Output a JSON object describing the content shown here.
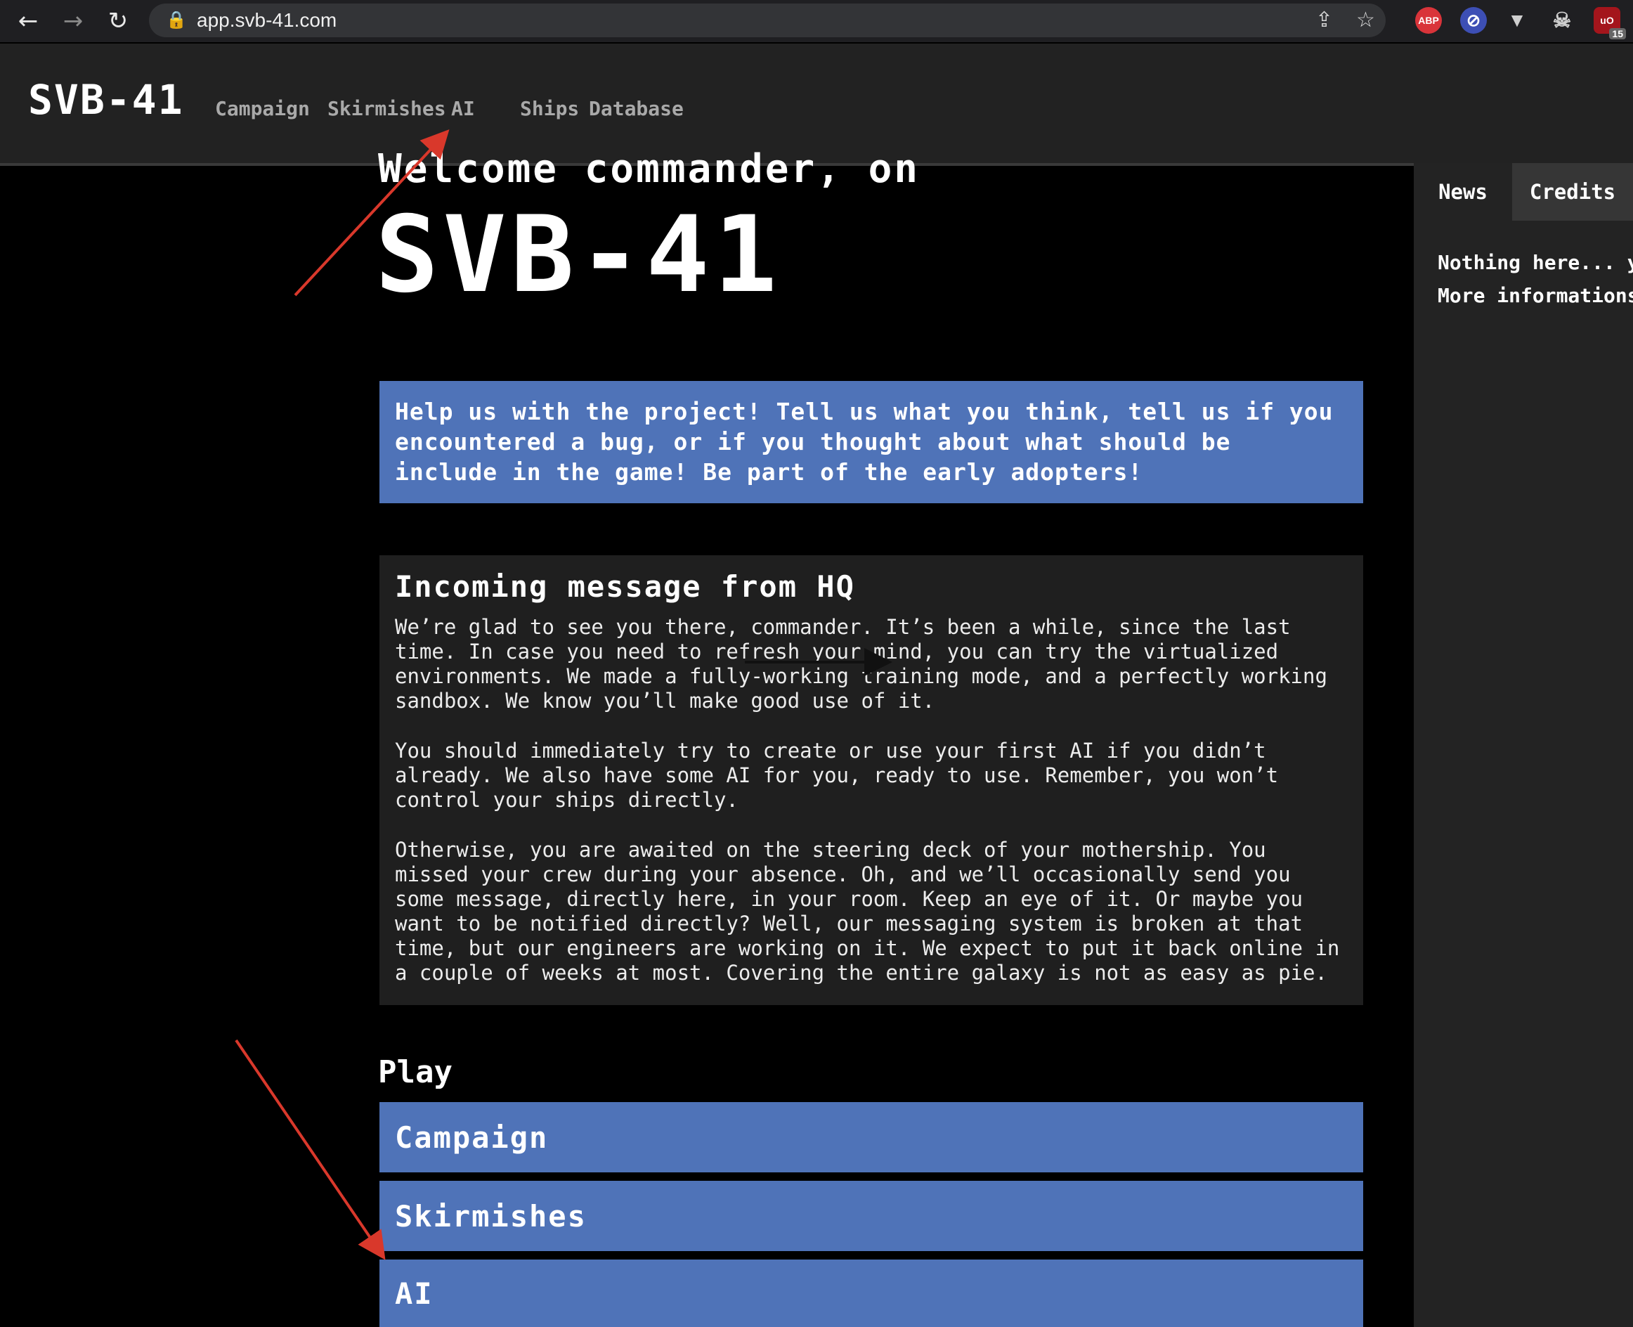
{
  "browser": {
    "back_icon": "←",
    "forward_icon": "→",
    "reload_icon": "↻",
    "lock_icon": "🔒",
    "url": "app.svb-41.com",
    "share_icon": "⇪",
    "star_icon": "☆",
    "extensions": [
      {
        "name": "adblock-plus-icon",
        "label": "ABP",
        "color": "#d9343a"
      },
      {
        "name": "privacy-badger-icon",
        "label": "⊘",
        "color": "#3d4fb5"
      },
      {
        "name": "vue-devtools-icon",
        "label": "▼",
        "color": "transparent"
      },
      {
        "name": "skull-extension-icon",
        "label": "☠",
        "color": "transparent"
      },
      {
        "name": "ublock-origin-icon",
        "label": "uO",
        "color": "#a4151c"
      }
    ],
    "extension_badge": "15"
  },
  "header": {
    "logo": "SVB-41",
    "nav": {
      "campaign": "Campaign",
      "skirmishes": "Skirmishes",
      "ai": "AI",
      "ships": "Ships",
      "database": "Database"
    }
  },
  "main": {
    "welcome": "Welcome commander, on",
    "title": "SVB-41",
    "banner": "Help us with the project! Tell us what you think, tell us if you encountered a bug, or if you thought about what should be include in the game! Be part of the early adopters!",
    "message": {
      "title": "Incoming message from HQ",
      "paragraphs": [
        "We’re glad to see you there, commander. It’s been a while, since the last time. In case you need to refresh your mind, you can try the virtualized environments. We made a fully-working training mode, and a perfectly working sandbox. We know you’ll make good use of it.",
        "You should immediately try to create or use your first AI if you didn’t already. We also have some AI for you, ready to use. Remember, you won’t control your ships directly.",
        "Otherwise, you are awaited on the steering deck of your mothership. You missed your crew during your absence. Oh, and we’ll occasionally send you some message, directly here, in your room. Keep an eye of it. Or maybe you want to be notified directly? Well, our messaging system is broken at that time, but our engineers are working on it. We expect to put it back online in a couple of weeks at most. Covering the entire galaxy is not as easy as pie."
      ]
    },
    "play": {
      "title": "Play",
      "campaign": "Campaign",
      "skirmishes": "Skirmishes",
      "ai": "AI"
    }
  },
  "sidebar": {
    "tab_news": "News",
    "tab_credits": "Credits",
    "line1": "Nothing here... yet!",
    "line2": "More informations"
  },
  "colors": {
    "accent_blue": "#4f73b8",
    "annotation_red": "#d9382b"
  }
}
